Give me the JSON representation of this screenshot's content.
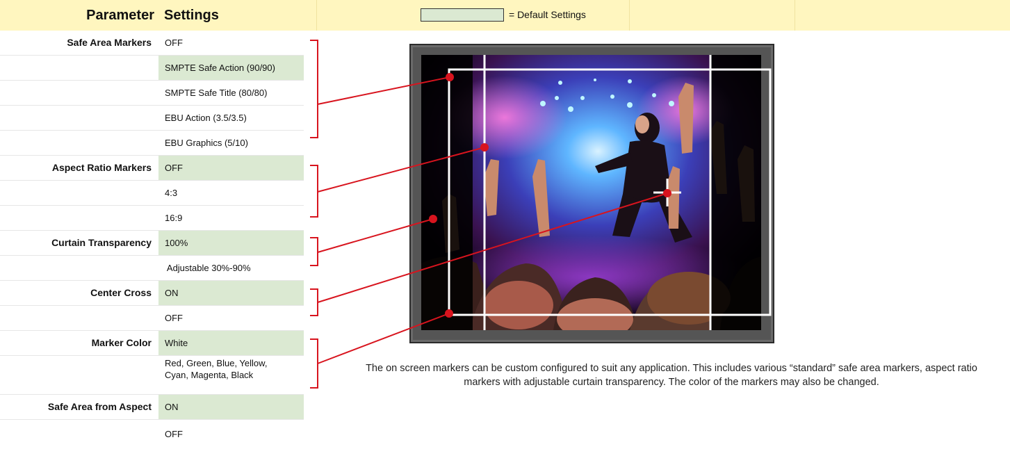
{
  "header": {
    "parameter_label": "Parameter",
    "settings_label": "Settings",
    "legend_text": "= Default Settings",
    "legend_color": "#dbe9d2",
    "header_color": "#fff6bf"
  },
  "rows": [
    {
      "param": "Safe Area Markers",
      "value": "OFF",
      "default": false
    },
    {
      "param": "",
      "value": "SMPTE Safe Action (90/90)",
      "default": true
    },
    {
      "param": "",
      "value": "SMPTE Safe Title (80/80)",
      "default": false
    },
    {
      "param": "",
      "value": "EBU Action (3.5/3.5)",
      "default": false
    },
    {
      "param": "",
      "value": "EBU Graphics (5/10)",
      "default": false
    },
    {
      "param": "Aspect Ratio Markers",
      "value": "OFF",
      "default": true
    },
    {
      "param": "",
      "value": "4:3",
      "default": false
    },
    {
      "param": "",
      "value": "16:9",
      "default": false
    },
    {
      "param": "Curtain Transparency",
      "value": "100%",
      "default": true
    },
    {
      "param": "",
      "value": " Adjustable 30%-90%",
      "default": false
    },
    {
      "param": "Center Cross",
      "value": "ON",
      "default": true
    },
    {
      "param": "",
      "value": "OFF",
      "default": false
    },
    {
      "param": "Marker Color",
      "value": "White",
      "default": true
    },
    {
      "param": "",
      "value": "Red, Green, Blue, Yellow,",
      "value2": "Cyan, Magenta, Black",
      "default": false
    },
    {
      "param": "Safe Area from Aspect",
      "value": "ON",
      "default": true
    },
    {
      "param": "",
      "value": "OFF",
      "default": false
    }
  ],
  "caption": "The on screen markers can be custom configured to suit any application. This includes various “standard” safe area markers, aspect ratio markers with adjustable curtain transparency. The color of the markers may also be changed.",
  "colors": {
    "callout_red": "#d8141e",
    "marker_white": "#ffffff"
  }
}
